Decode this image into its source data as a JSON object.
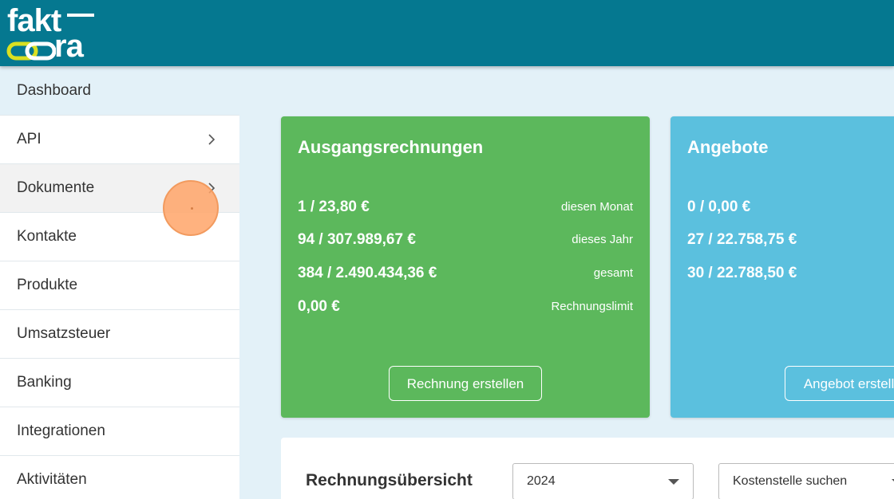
{
  "brand": {
    "logo_top": "fakt",
    "logo_bottom": "ra",
    "colors": {
      "header": "#057890",
      "ring": "#d9e021"
    }
  },
  "sidebar": {
    "title": "Dashboard",
    "items": [
      {
        "label": "API",
        "chevron": true
      },
      {
        "label": "Dokumente",
        "chevron": true
      },
      {
        "label": "Kontakte"
      },
      {
        "label": "Produkte"
      },
      {
        "label": "Umsatzsteuer"
      },
      {
        "label": "Banking"
      },
      {
        "label": "Integrationen"
      },
      {
        "label": "Aktivitäten"
      }
    ]
  },
  "cards": {
    "invoices": {
      "title": "Ausgangsrechnungen",
      "color": "#5cb85c",
      "rows": [
        {
          "value": "1 / 23,80 €",
          "label": "diesen Monat"
        },
        {
          "value": "94 / 307.989,67 €",
          "label": "dieses Jahr"
        },
        {
          "value": "384 / 2.490.434,36 €",
          "label": "gesamt"
        },
        {
          "value": "0,00 €",
          "label": "Rechnungslimit"
        }
      ],
      "button": "Rechnung erstellen"
    },
    "offers": {
      "title": "Angebote",
      "color": "#5bc0de",
      "rows": [
        {
          "value": "0 / 0,00 €"
        },
        {
          "value": "27 / 22.758,75 €"
        },
        {
          "value": "30 / 22.788,50 €"
        }
      ],
      "button": "Angebot erstellen"
    }
  },
  "overview": {
    "title": "Rechnungsübersicht",
    "year_select": "2024",
    "cost_center_select": "Kostenstelle suchen"
  }
}
